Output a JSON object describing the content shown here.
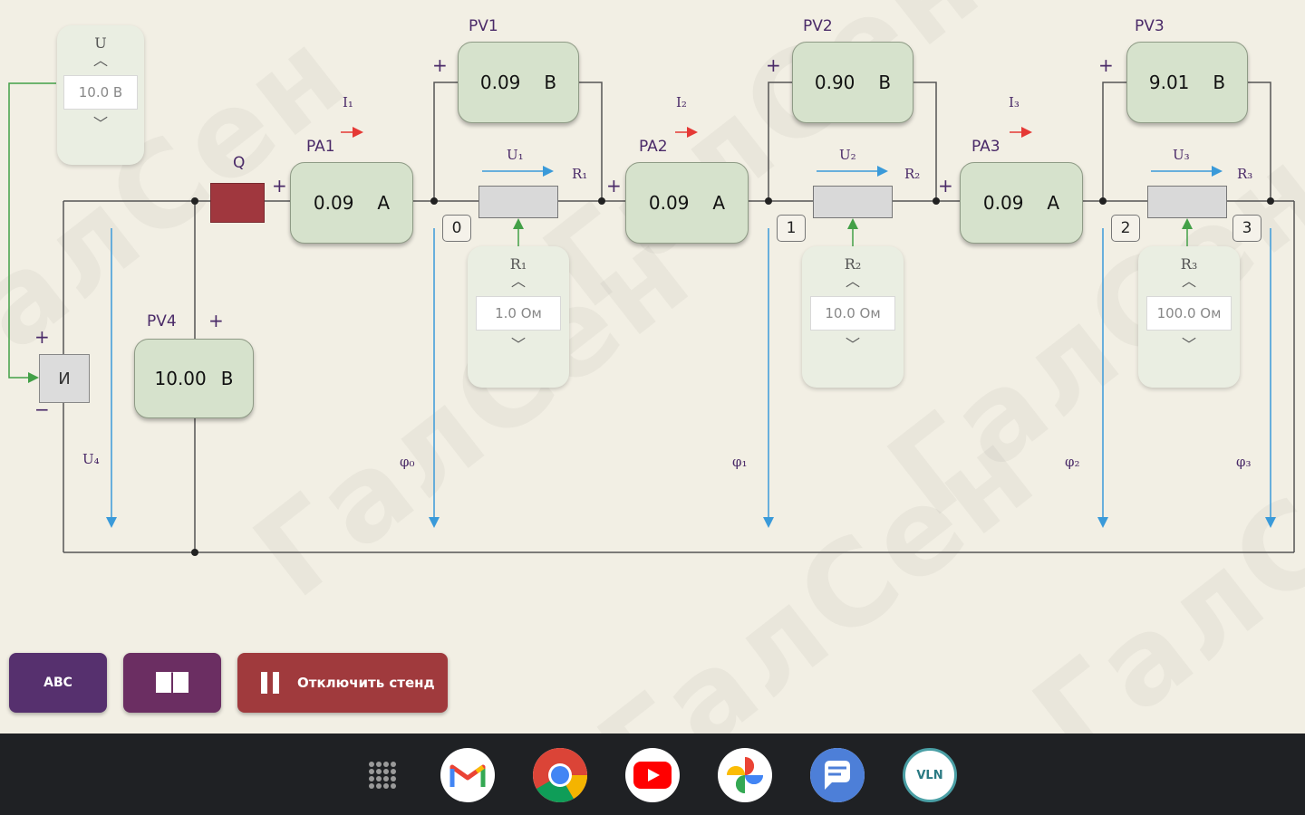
{
  "watermark": "ГалСен",
  "source_control": {
    "title": "U",
    "value": "10.0 В"
  },
  "source": {
    "label": "И",
    "plus": "+",
    "minus": "−"
  },
  "switch": {
    "label": "Q"
  },
  "ammeters": [
    {
      "name": "PA1",
      "value": "0.09",
      "unit": "А",
      "plus": "+"
    },
    {
      "name": "PA2",
      "value": "0.09",
      "unit": "А",
      "plus": "+"
    },
    {
      "name": "PA3",
      "value": "0.09",
      "unit": "А",
      "plus": "+"
    }
  ],
  "voltmeters": [
    {
      "name": "PV1",
      "value": "0.09",
      "unit": "В",
      "plus": "+"
    },
    {
      "name": "PV2",
      "value": "0.90",
      "unit": "В",
      "plus": "+"
    },
    {
      "name": "PV3",
      "value": "9.01",
      "unit": "В",
      "plus": "+"
    }
  ],
  "pv4": {
    "name": "PV4",
    "value": "10.00",
    "unit": "В",
    "plus": "+"
  },
  "currents": [
    "I₁",
    "I₂",
    "I₃"
  ],
  "voltages": [
    "U₁",
    "U₂",
    "U₃"
  ],
  "u4": "U₄",
  "resistors": [
    {
      "name": "R₁",
      "control_title": "R₁",
      "value": "1.0  Ом"
    },
    {
      "name": "R₂",
      "control_title": "R₂",
      "value": "10.0  Ом"
    },
    {
      "name": "R₃",
      "control_title": "R₃",
      "value": "100.0 Ом"
    }
  ],
  "nodes": [
    "0",
    "1",
    "2",
    "3"
  ],
  "potentials": [
    "φ₀",
    "φ₁",
    "φ₂",
    "φ₃"
  ],
  "buttons": {
    "abc": "АВС",
    "stop": "Отключить стенд"
  },
  "colors": {
    "wire": "#555555",
    "measure_arrow": "#3a9ad9",
    "current_arrow": "#e53935",
    "control_wire": "#43a047"
  },
  "taskbar": {
    "apps": [
      {
        "name": "Gmail",
        "icon": "gmail-icon"
      },
      {
        "name": "Chrome",
        "icon": "chrome-icon"
      },
      {
        "name": "YouTube",
        "icon": "youtube-icon"
      },
      {
        "name": "Photos",
        "icon": "photos-icon"
      },
      {
        "name": "Messages",
        "icon": "messages-icon"
      },
      {
        "name": "VLN",
        "icon": "vln-icon",
        "text": "VLN"
      }
    ]
  }
}
